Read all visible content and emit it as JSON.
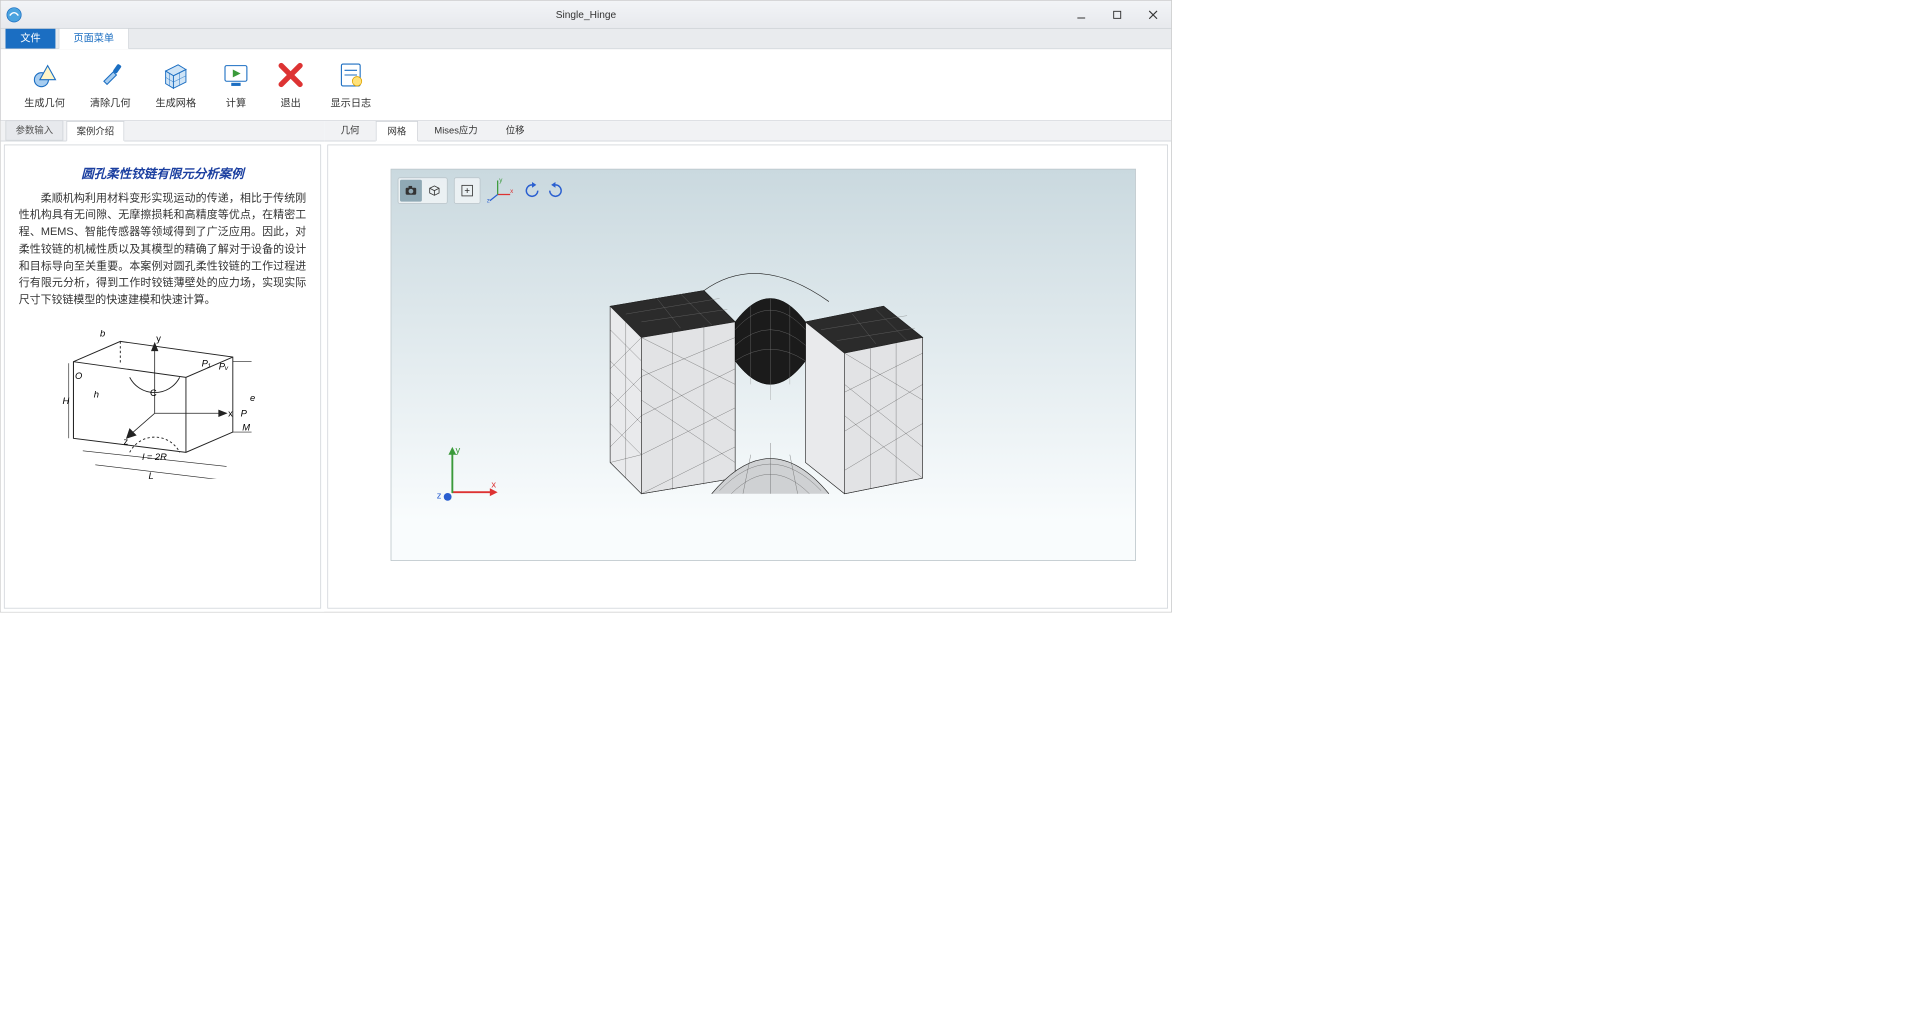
{
  "window": {
    "title": "Single_Hinge"
  },
  "ribbon_tabs": {
    "file": "文件",
    "page_menu": "页面菜单"
  },
  "toolbar": {
    "gen_geom": "生成几何",
    "clear_geom": "清除几何",
    "gen_mesh": "生成网格",
    "compute": "计算",
    "exit": "退出",
    "show_log": "显示日志"
  },
  "left_tabs": {
    "param_input": "参数输入",
    "case_intro": "案例介绍"
  },
  "intro": {
    "title": "圆孔柔性铰链有限元分析案例",
    "body": "柔顺机构利用材料变形实现运动的传递，相比于传统刚性机构具有无间隙、无摩擦损耗和高精度等优点，在精密工程、MEMS、智能传感器等领域得到了广泛应用。因此，对柔性铰链的机械性质以及其模型的精确了解对于设备的设计和目标导向至关重要。本案例对圆孔柔性铰链的工作过程进行有限元分析，得到工作时铰链薄壁处的应力场，实现实际尺寸下铰链模型的快速建模和快速计算。"
  },
  "diagram_labels": {
    "O": "O",
    "H": "H",
    "b": "b",
    "h": "h",
    "y": "y",
    "z": "z",
    "x": "x",
    "C": "C",
    "P1": "P₁",
    "Pv": "Pᵥ",
    "e": "e",
    "P": "P",
    "M": "M",
    "l2R": "l = 2R",
    "L": "L"
  },
  "view_tabs": {
    "geom": "几何",
    "mesh": "网格",
    "mises": "Mises应力",
    "disp": "位移"
  },
  "axes": {
    "x": "x",
    "y": "y",
    "z": "z"
  }
}
